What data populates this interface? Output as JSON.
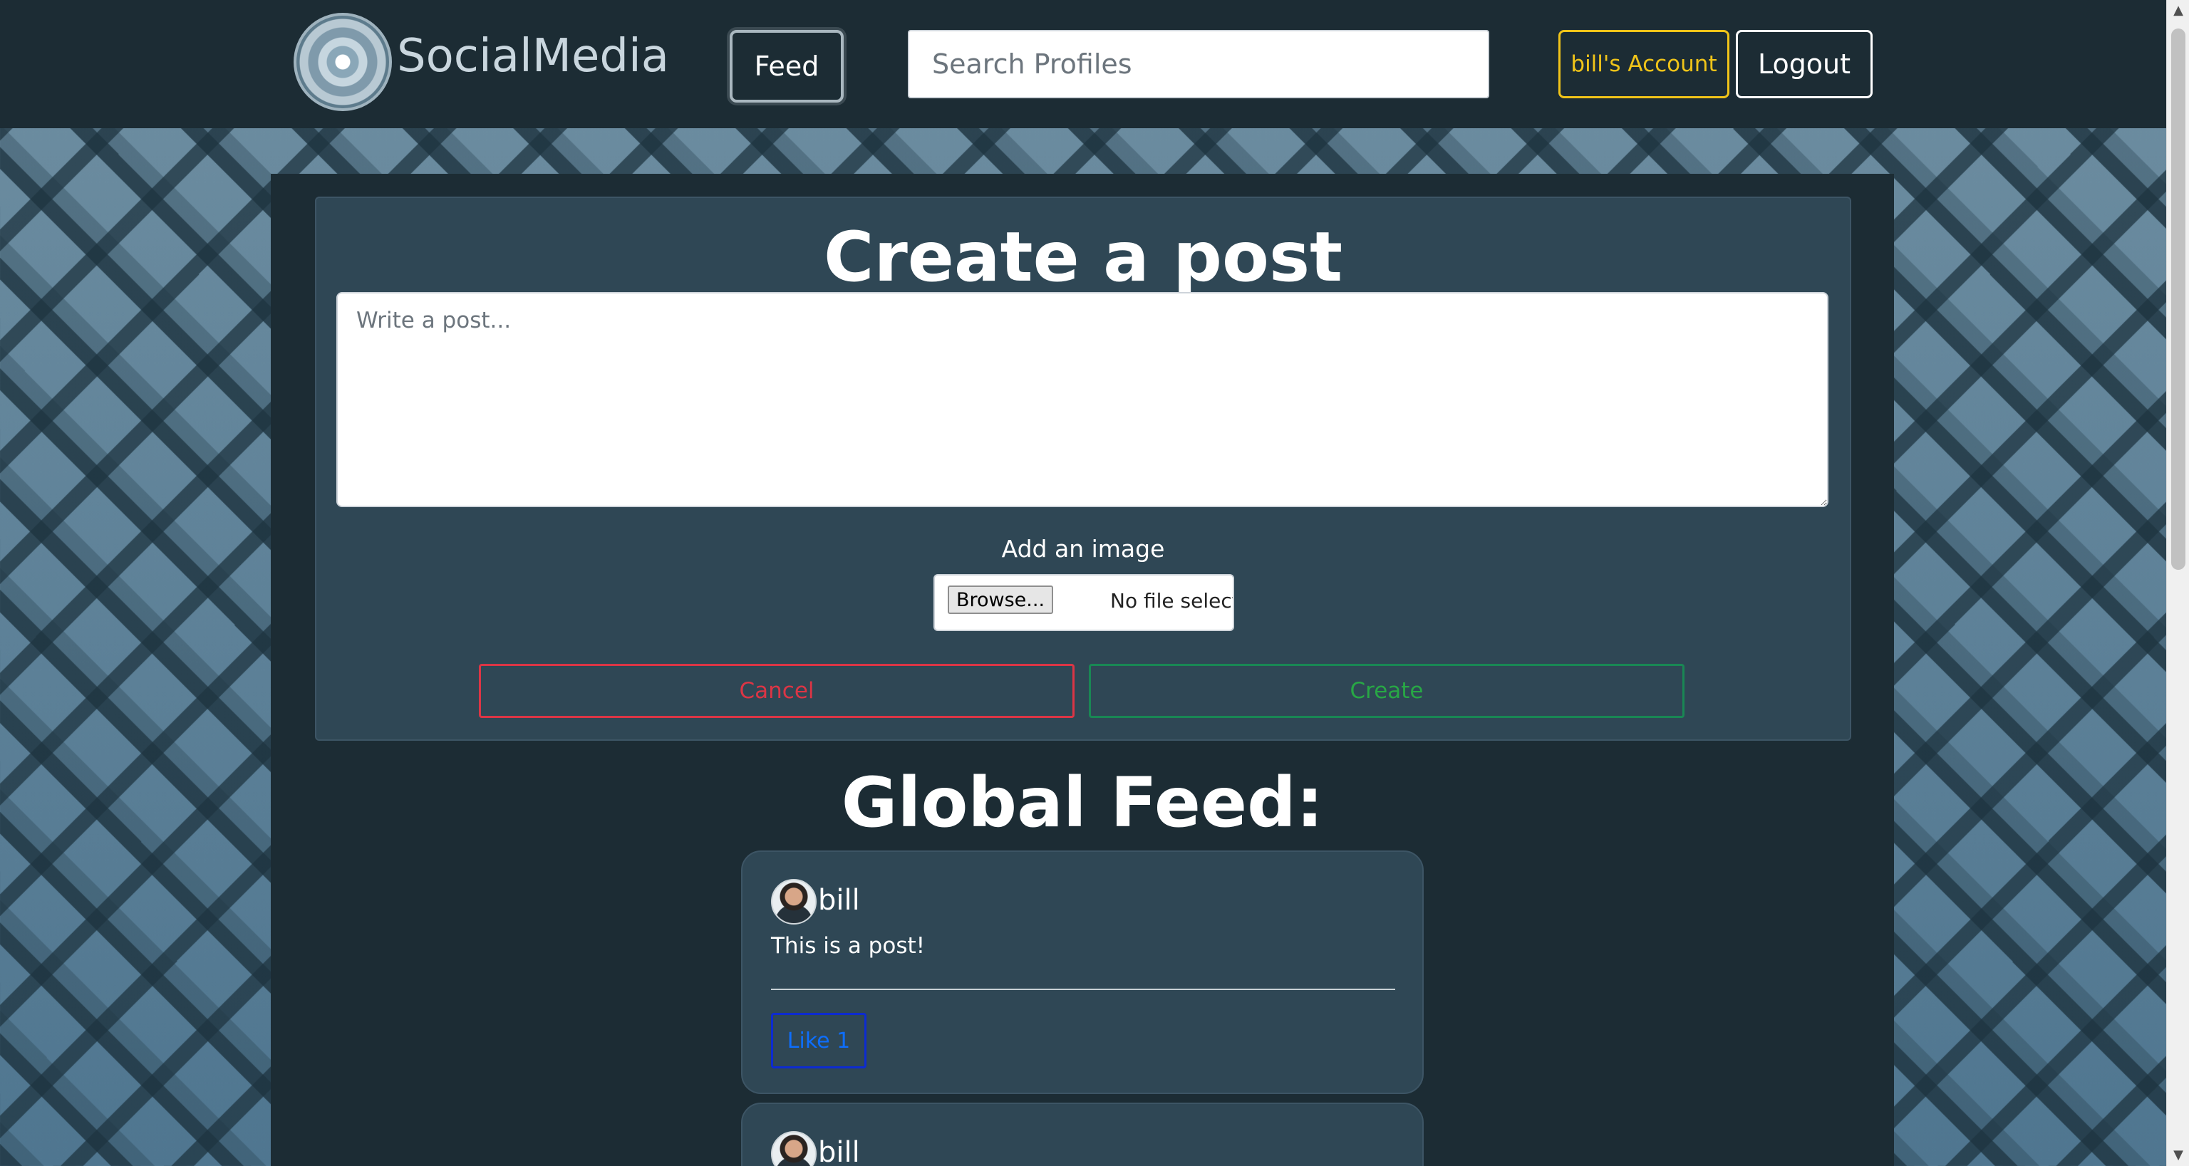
{
  "nav": {
    "brand": "SocialMedia",
    "feed_label": "Feed",
    "search_placeholder": "Search Profiles",
    "account_label": "bill's Account",
    "logout_label": "Logout"
  },
  "create_post": {
    "title": "Create a post",
    "textarea_placeholder": "Write a post...",
    "image_label": "Add an image",
    "browse_label": "Browse...",
    "file_status": "No file selected.",
    "cancel_label": "Cancel",
    "create_label": "Create"
  },
  "feed": {
    "title": "Global Feed:",
    "posts": [
      {
        "author": "bill",
        "text": "This is a post!",
        "like_label": "Like 1"
      },
      {
        "author": "bill"
      }
    ]
  },
  "colors": {
    "navbar": "#1c2c34",
    "card": "#2f4755",
    "account_accent": "#f0c419",
    "cancel": "#dc3545",
    "create": "#198754",
    "like": "#0d6efd"
  },
  "icons": {
    "logo": "decorative-mandala-logo-icon",
    "avatar": "user-photo-avatar"
  }
}
